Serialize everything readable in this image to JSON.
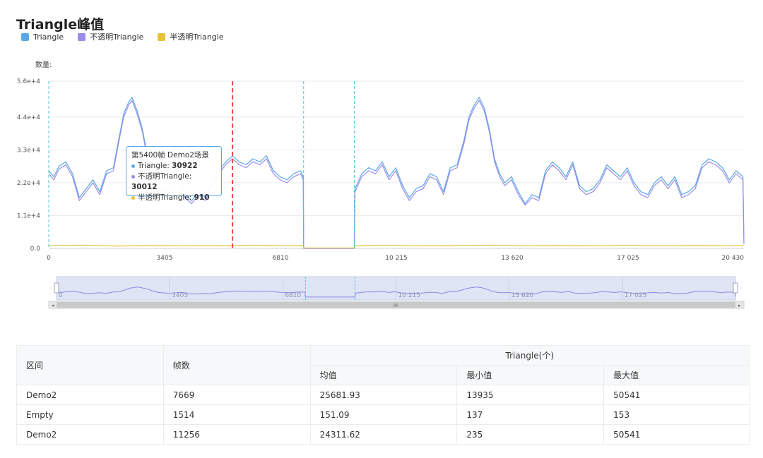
{
  "page": {
    "title": "Triangle峰值",
    "y_unit_label": "数量:"
  },
  "legend": [
    {
      "label": "Triangle",
      "color": "#5aa9e6"
    },
    {
      "label": "不透明Triangle",
      "color": "#9b8ceb"
    },
    {
      "label": "半透明Triangle",
      "color": "#e8c23a"
    }
  ],
  "chart_data": {
    "type": "line",
    "x_range": [
      0,
      20430
    ],
    "y_range": [
      0,
      56000
    ],
    "y_ticks": [
      "0.0",
      "1.1e+4",
      "2.2e+4",
      "3.3e+4",
      "4.4e+4",
      "5.6e+4"
    ],
    "y_tick_values": [
      0,
      11000,
      22000,
      33000,
      44000,
      56000
    ],
    "x_ticks": [
      "0",
      "3405",
      "6810",
      "10 215",
      "13 620",
      "17 025",
      "20 430"
    ],
    "x_tick_values": [
      0,
      3405,
      6810,
      10215,
      13620,
      17025,
      20430
    ],
    "series": [
      {
        "name": "Triangle",
        "color": "#5aa9e6",
        "points": [
          [
            0,
            26000
          ],
          [
            150,
            24000
          ],
          [
            300,
            27500
          ],
          [
            500,
            29000
          ],
          [
            700,
            25000
          ],
          [
            900,
            17000
          ],
          [
            1100,
            20000
          ],
          [
            1300,
            23000
          ],
          [
            1500,
            19000
          ],
          [
            1700,
            26000
          ],
          [
            1900,
            27000
          ],
          [
            2050,
            36000
          ],
          [
            2200,
            45000
          ],
          [
            2350,
            49000
          ],
          [
            2450,
            50541
          ],
          [
            2600,
            46000
          ],
          [
            2750,
            40000
          ],
          [
            2900,
            31000
          ],
          [
            3050,
            24000
          ],
          [
            3200,
            22000
          ],
          [
            3400,
            19000
          ],
          [
            3600,
            23000
          ],
          [
            3800,
            24000
          ],
          [
            4000,
            18000
          ],
          [
            4200,
            16000
          ],
          [
            4400,
            19000
          ],
          [
            4600,
            17000
          ],
          [
            4800,
            22000
          ],
          [
            5000,
            26000
          ],
          [
            5200,
            29000
          ],
          [
            5400,
            30922
          ],
          [
            5600,
            29000
          ],
          [
            5800,
            28000
          ],
          [
            6000,
            30000
          ],
          [
            6200,
            29000
          ],
          [
            6400,
            31000
          ],
          [
            6600,
            26000
          ],
          [
            6800,
            24000
          ],
          [
            7000,
            23000
          ],
          [
            7200,
            25000
          ],
          [
            7400,
            26000
          ],
          [
            7480,
            24000
          ],
          [
            7490,
            0
          ],
          [
            8980,
            0
          ],
          [
            9000,
            20000
          ],
          [
            9200,
            25000
          ],
          [
            9400,
            27000
          ],
          [
            9600,
            26000
          ],
          [
            9800,
            29000
          ],
          [
            10000,
            24000
          ],
          [
            10200,
            27000
          ],
          [
            10400,
            21000
          ],
          [
            10600,
            17000
          ],
          [
            10800,
            20000
          ],
          [
            11000,
            21000
          ],
          [
            11200,
            25000
          ],
          [
            11400,
            24000
          ],
          [
            11600,
            19000
          ],
          [
            11800,
            27000
          ],
          [
            12000,
            28000
          ],
          [
            12200,
            36000
          ],
          [
            12350,
            44000
          ],
          [
            12500,
            48000
          ],
          [
            12650,
            50541
          ],
          [
            12800,
            47000
          ],
          [
            12950,
            40000
          ],
          [
            13100,
            30000
          ],
          [
            13250,
            25000
          ],
          [
            13400,
            22000
          ],
          [
            13600,
            24000
          ],
          [
            13800,
            19000
          ],
          [
            14000,
            15000
          ],
          [
            14200,
            18000
          ],
          [
            14400,
            17000
          ],
          [
            14600,
            26000
          ],
          [
            14800,
            29000
          ],
          [
            15000,
            27000
          ],
          [
            15200,
            24000
          ],
          [
            15400,
            29000
          ],
          [
            15600,
            21000
          ],
          [
            15800,
            19000
          ],
          [
            16000,
            20000
          ],
          [
            16200,
            23000
          ],
          [
            16400,
            28000
          ],
          [
            16600,
            26000
          ],
          [
            16800,
            24000
          ],
          [
            17000,
            27000
          ],
          [
            17200,
            22000
          ],
          [
            17400,
            19000
          ],
          [
            17600,
            18000
          ],
          [
            17800,
            22000
          ],
          [
            18000,
            24000
          ],
          [
            18200,
            21000
          ],
          [
            18400,
            24000
          ],
          [
            18600,
            18000
          ],
          [
            18800,
            19000
          ],
          [
            19000,
            21000
          ],
          [
            19200,
            28000
          ],
          [
            19400,
            30000
          ],
          [
            19600,
            29000
          ],
          [
            19800,
            27000
          ],
          [
            20000,
            23000
          ],
          [
            20200,
            26000
          ],
          [
            20400,
            24000
          ],
          [
            20430,
            2000
          ]
        ]
      },
      {
        "name": "不透明Triangle",
        "color": "#9b8ceb",
        "points": [
          [
            0,
            25000
          ],
          [
            150,
            23000
          ],
          [
            300,
            26500
          ],
          [
            500,
            28000
          ],
          [
            700,
            24000
          ],
          [
            900,
            16000
          ],
          [
            1100,
            19000
          ],
          [
            1300,
            22000
          ],
          [
            1500,
            18000
          ],
          [
            1700,
            25000
          ],
          [
            1900,
            26000
          ],
          [
            2050,
            35000
          ],
          [
            2200,
            44000
          ],
          [
            2350,
            48000
          ],
          [
            2450,
            49500
          ],
          [
            2600,
            45000
          ],
          [
            2750,
            39000
          ],
          [
            2900,
            30000
          ],
          [
            3050,
            23000
          ],
          [
            3200,
            21000
          ],
          [
            3400,
            18000
          ],
          [
            3600,
            22000
          ],
          [
            3800,
            23000
          ],
          [
            4000,
            17000
          ],
          [
            4200,
            15000
          ],
          [
            4400,
            18000
          ],
          [
            4600,
            16000
          ],
          [
            4800,
            21000
          ],
          [
            5000,
            25000
          ],
          [
            5200,
            28000
          ],
          [
            5400,
            30012
          ],
          [
            5600,
            28000
          ],
          [
            5800,
            27000
          ],
          [
            6000,
            29000
          ],
          [
            6200,
            28000
          ],
          [
            6400,
            30000
          ],
          [
            6600,
            25000
          ],
          [
            6800,
            23000
          ],
          [
            7000,
            22000
          ],
          [
            7200,
            24000
          ],
          [
            7400,
            25000
          ],
          [
            7480,
            23000
          ],
          [
            7490,
            0
          ],
          [
            8980,
            0
          ],
          [
            9000,
            19000
          ],
          [
            9200,
            24000
          ],
          [
            9400,
            26000
          ],
          [
            9600,
            25000
          ],
          [
            9800,
            28000
          ],
          [
            10000,
            23000
          ],
          [
            10200,
            26000
          ],
          [
            10400,
            20000
          ],
          [
            10600,
            16000
          ],
          [
            10800,
            19000
          ],
          [
            11000,
            20000
          ],
          [
            11200,
            24000
          ],
          [
            11400,
            23000
          ],
          [
            11600,
            18000
          ],
          [
            11800,
            26000
          ],
          [
            12000,
            27000
          ],
          [
            12200,
            35000
          ],
          [
            12350,
            43000
          ],
          [
            12500,
            47000
          ],
          [
            12650,
            49500
          ],
          [
            12800,
            46000
          ],
          [
            12950,
            39000
          ],
          [
            13100,
            29000
          ],
          [
            13250,
            24000
          ],
          [
            13400,
            21000
          ],
          [
            13600,
            23000
          ],
          [
            13800,
            18000
          ],
          [
            14000,
            14500
          ],
          [
            14200,
            17000
          ],
          [
            14400,
            16000
          ],
          [
            14600,
            25000
          ],
          [
            14800,
            28000
          ],
          [
            15000,
            26000
          ],
          [
            15200,
            23000
          ],
          [
            15400,
            28000
          ],
          [
            15600,
            20000
          ],
          [
            15800,
            18000
          ],
          [
            16000,
            19000
          ],
          [
            16200,
            22000
          ],
          [
            16400,
            27000
          ],
          [
            16600,
            25000
          ],
          [
            16800,
            23000
          ],
          [
            17000,
            26000
          ],
          [
            17200,
            21000
          ],
          [
            17400,
            18000
          ],
          [
            17600,
            17000
          ],
          [
            17800,
            21000
          ],
          [
            18000,
            23000
          ],
          [
            18200,
            20000
          ],
          [
            18400,
            23000
          ],
          [
            18600,
            17000
          ],
          [
            18800,
            18000
          ],
          [
            19000,
            20000
          ],
          [
            19200,
            27000
          ],
          [
            19400,
            29000
          ],
          [
            19600,
            28000
          ],
          [
            19800,
            26000
          ],
          [
            20000,
            22000
          ],
          [
            20200,
            25000
          ],
          [
            20400,
            23000
          ],
          [
            20430,
            1500
          ]
        ]
      },
      {
        "name": "半透明Triangle",
        "color": "#e8c23a",
        "points": [
          [
            0,
            900
          ],
          [
            1000,
            1100
          ],
          [
            2000,
            800
          ],
          [
            3000,
            950
          ],
          [
            4000,
            850
          ],
          [
            5400,
            910
          ],
          [
            6000,
            1000
          ],
          [
            7000,
            900
          ],
          [
            7480,
            950
          ],
          [
            7490,
            150
          ],
          [
            8980,
            150
          ],
          [
            9000,
            900
          ],
          [
            10000,
            1000
          ],
          [
            11000,
            850
          ],
          [
            12000,
            950
          ],
          [
            13000,
            1100
          ],
          [
            14000,
            900
          ],
          [
            15000,
            950
          ],
          [
            16000,
            850
          ],
          [
            17000,
            1000
          ],
          [
            18000,
            900
          ],
          [
            19000,
            950
          ],
          [
            20000,
            900
          ],
          [
            20430,
            850
          ]
        ]
      }
    ],
    "markers": {
      "cyan_dashed_x": [
        0,
        7490,
        8980
      ],
      "red_dashed_x": 5400
    },
    "tooltip": {
      "header": "第5400帧 Demo2场景",
      "rows": [
        {
          "label": "Triangle: ",
          "value": "30922",
          "color": "#5aa9e6"
        },
        {
          "label": "不透明Triangle: ",
          "value": "30012",
          "color": "#9b8ceb"
        },
        {
          "label": "半透明Triangle: ",
          "value": "910",
          "color": "#e8c23a"
        }
      ]
    },
    "zoom_slider": {
      "x_ticks": [
        "0",
        "3405",
        "6810",
        "10 215",
        "13 620",
        "17 025"
      ],
      "x_tick_values": [
        0,
        3405,
        6810,
        10215,
        13620,
        17025
      ],
      "scroll_grip": "III"
    }
  },
  "table": {
    "headers": {
      "range": "区间",
      "frames": "帧数",
      "group": "Triangle(个)",
      "mean": "均值",
      "min": "最小值",
      "max": "最大值"
    },
    "rows": [
      {
        "range": "Demo2",
        "frames": "7669",
        "mean": "25681.93",
        "min": "13935",
        "max": "50541"
      },
      {
        "range": "Empty",
        "frames": "1514",
        "mean": "151.09",
        "min": "137",
        "max": "153"
      },
      {
        "range": "Demo2",
        "frames": "11256",
        "mean": "24311.62",
        "min": "235",
        "max": "50541"
      }
    ]
  }
}
